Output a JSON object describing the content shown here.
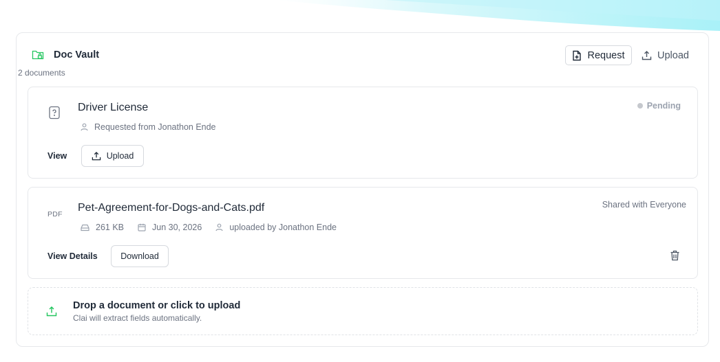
{
  "vault": {
    "title": "Doc Vault",
    "count_label": "2 documents",
    "icon": "folder-lock-icon",
    "accent_color": "#22c55e"
  },
  "actions": {
    "request_label": "Request",
    "upload_label": "Upload"
  },
  "documents": [
    {
      "title": "Driver License",
      "icon": "file-question-icon",
      "status": "Pending",
      "requested_from": "Requested from Jonathon Ende",
      "view_label": "View",
      "upload_label": "Upload"
    },
    {
      "title": "Pet-Agreement-for-Dogs-and-Cats.pdf",
      "type_label": "PDF",
      "visibility": "Shared with Everyone",
      "size": "261 KB",
      "date": "Jun 30, 2026",
      "uploaded_by": "uploaded by Jonathon Ende",
      "view_label": "View Details",
      "download_label": "Download"
    }
  ],
  "dropzone": {
    "title": "Drop a document or click to upload",
    "subtitle": "Clai will extract fields automatically."
  }
}
